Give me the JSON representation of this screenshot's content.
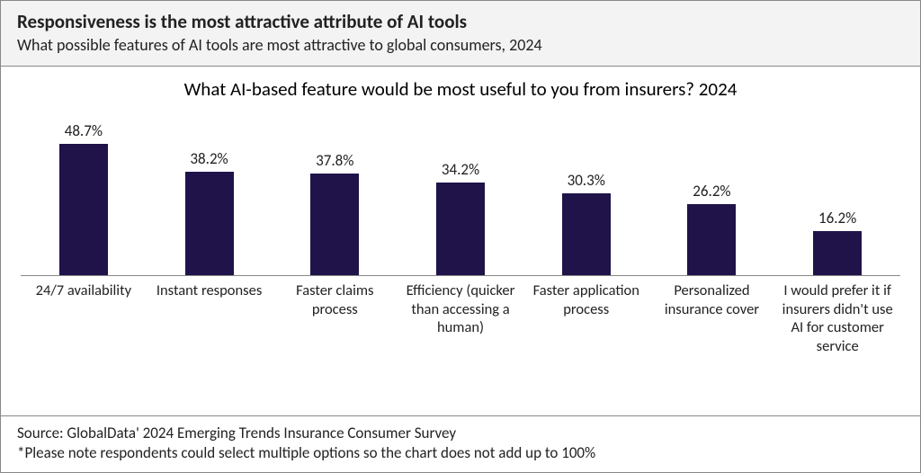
{
  "header": {
    "title": "Responsiveness is the most attractive attribute of AI tools",
    "subtitle": "What possible features of AI tools are most attractive to global consumers, 2024"
  },
  "chart_data": {
    "type": "bar",
    "title": "What AI-based feature would be most useful to you from insurers? 2024",
    "categories": [
      "24/7 availability",
      "Instant responses",
      "Faster claims process",
      "Efficiency (quicker than accessing a human)",
      "Faster application process",
      "Personalized insurance cover",
      "I would prefer it if insurers didn't use AI for customer service"
    ],
    "values": [
      48.7,
      38.2,
      37.8,
      34.2,
      30.3,
      26.2,
      16.2
    ],
    "value_labels": [
      "48.7%",
      "38.2%",
      "37.8%",
      "34.2%",
      "30.3%",
      "26.2%",
      "16.2%"
    ],
    "xlabel": "",
    "ylabel": "",
    "ylim": [
      0,
      50
    ]
  },
  "footer": {
    "source": "Source: GlobalData' 2024  Emerging Trends Insurance Consumer Survey",
    "note": "*Please note respondents could select multiple options so the chart does not add up to 100%"
  }
}
